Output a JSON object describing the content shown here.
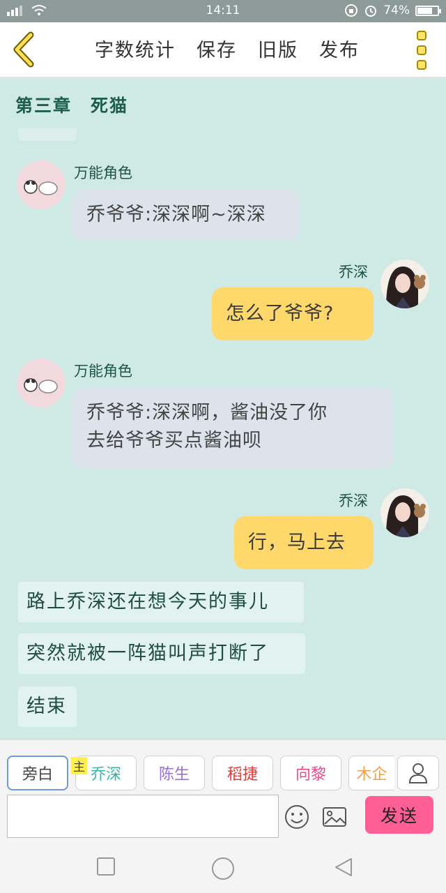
{
  "status": {
    "time": "14:11",
    "battery": "74%",
    "battery_level": 0.74
  },
  "toolbar": {
    "word_count": "字数统计",
    "save": "保存",
    "old_version": "旧版",
    "publish": "发布"
  },
  "chapter_title": "第三章　死猫",
  "messages": [
    {
      "sender": "万能角色",
      "text": "乔爷爷:深深啊~深深",
      "side": "left"
    },
    {
      "sender": "乔深",
      "text": "怎么了爷爷?",
      "side": "right"
    },
    {
      "sender": "万能角色",
      "text_line1": "乔爷爷:深深啊，酱油没了你",
      "text_line2": "去给爷爷买点酱油呗",
      "side": "left"
    },
    {
      "sender": "乔深",
      "text": "行，马上去",
      "side": "right"
    }
  ],
  "narration": [
    "路上乔深还在想今天的事儿",
    "突然就被一阵猫叫声打断了",
    "结束"
  ],
  "roles": [
    {
      "label": "旁白",
      "color": "#444444"
    },
    {
      "label": "乔深",
      "color": "#3bb5a6"
    },
    {
      "label": "陈生",
      "color": "#9a6cd8"
    },
    {
      "label": "稻捷",
      "color": "#e53935"
    },
    {
      "label": "向黎",
      "color": "#e84c8a"
    },
    {
      "label": "木企",
      "color": "#f0a050"
    }
  ],
  "master_badge": "主",
  "input": {
    "value": "",
    "placeholder": ""
  },
  "send_label": "发送",
  "colors": {
    "send": "#ff5f95",
    "bubble_right": "#ffd86b",
    "bubble_left": "#dde3ea",
    "background": "#cfe9e5"
  }
}
